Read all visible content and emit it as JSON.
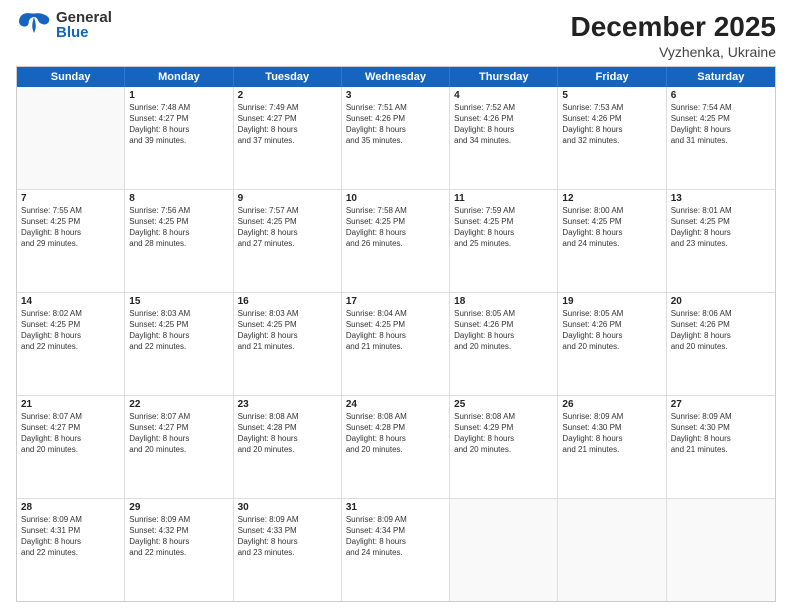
{
  "header": {
    "logo_general": "General",
    "logo_blue": "Blue",
    "title": "December 2025",
    "subtitle": "Vyzhenka, Ukraine"
  },
  "calendar": {
    "days_of_week": [
      "Sunday",
      "Monday",
      "Tuesday",
      "Wednesday",
      "Thursday",
      "Friday",
      "Saturday"
    ],
    "rows": [
      [
        {
          "day": "",
          "lines": []
        },
        {
          "day": "1",
          "lines": [
            "Sunrise: 7:48 AM",
            "Sunset: 4:27 PM",
            "Daylight: 8 hours",
            "and 39 minutes."
          ]
        },
        {
          "day": "2",
          "lines": [
            "Sunrise: 7:49 AM",
            "Sunset: 4:27 PM",
            "Daylight: 8 hours",
            "and 37 minutes."
          ]
        },
        {
          "day": "3",
          "lines": [
            "Sunrise: 7:51 AM",
            "Sunset: 4:26 PM",
            "Daylight: 8 hours",
            "and 35 minutes."
          ]
        },
        {
          "day": "4",
          "lines": [
            "Sunrise: 7:52 AM",
            "Sunset: 4:26 PM",
            "Daylight: 8 hours",
            "and 34 minutes."
          ]
        },
        {
          "day": "5",
          "lines": [
            "Sunrise: 7:53 AM",
            "Sunset: 4:26 PM",
            "Daylight: 8 hours",
            "and 32 minutes."
          ]
        },
        {
          "day": "6",
          "lines": [
            "Sunrise: 7:54 AM",
            "Sunset: 4:25 PM",
            "Daylight: 8 hours",
            "and 31 minutes."
          ]
        }
      ],
      [
        {
          "day": "7",
          "lines": [
            "Sunrise: 7:55 AM",
            "Sunset: 4:25 PM",
            "Daylight: 8 hours",
            "and 29 minutes."
          ]
        },
        {
          "day": "8",
          "lines": [
            "Sunrise: 7:56 AM",
            "Sunset: 4:25 PM",
            "Daylight: 8 hours",
            "and 28 minutes."
          ]
        },
        {
          "day": "9",
          "lines": [
            "Sunrise: 7:57 AM",
            "Sunset: 4:25 PM",
            "Daylight: 8 hours",
            "and 27 minutes."
          ]
        },
        {
          "day": "10",
          "lines": [
            "Sunrise: 7:58 AM",
            "Sunset: 4:25 PM",
            "Daylight: 8 hours",
            "and 26 minutes."
          ]
        },
        {
          "day": "11",
          "lines": [
            "Sunrise: 7:59 AM",
            "Sunset: 4:25 PM",
            "Daylight: 8 hours",
            "and 25 minutes."
          ]
        },
        {
          "day": "12",
          "lines": [
            "Sunrise: 8:00 AM",
            "Sunset: 4:25 PM",
            "Daylight: 8 hours",
            "and 24 minutes."
          ]
        },
        {
          "day": "13",
          "lines": [
            "Sunrise: 8:01 AM",
            "Sunset: 4:25 PM",
            "Daylight: 8 hours",
            "and 23 minutes."
          ]
        }
      ],
      [
        {
          "day": "14",
          "lines": [
            "Sunrise: 8:02 AM",
            "Sunset: 4:25 PM",
            "Daylight: 8 hours",
            "and 22 minutes."
          ]
        },
        {
          "day": "15",
          "lines": [
            "Sunrise: 8:03 AM",
            "Sunset: 4:25 PM",
            "Daylight: 8 hours",
            "and 22 minutes."
          ]
        },
        {
          "day": "16",
          "lines": [
            "Sunrise: 8:03 AM",
            "Sunset: 4:25 PM",
            "Daylight: 8 hours",
            "and 21 minutes."
          ]
        },
        {
          "day": "17",
          "lines": [
            "Sunrise: 8:04 AM",
            "Sunset: 4:25 PM",
            "Daylight: 8 hours",
            "and 21 minutes."
          ]
        },
        {
          "day": "18",
          "lines": [
            "Sunrise: 8:05 AM",
            "Sunset: 4:26 PM",
            "Daylight: 8 hours",
            "and 20 minutes."
          ]
        },
        {
          "day": "19",
          "lines": [
            "Sunrise: 8:05 AM",
            "Sunset: 4:26 PM",
            "Daylight: 8 hours",
            "and 20 minutes."
          ]
        },
        {
          "day": "20",
          "lines": [
            "Sunrise: 8:06 AM",
            "Sunset: 4:26 PM",
            "Daylight: 8 hours",
            "and 20 minutes."
          ]
        }
      ],
      [
        {
          "day": "21",
          "lines": [
            "Sunrise: 8:07 AM",
            "Sunset: 4:27 PM",
            "Daylight: 8 hours",
            "and 20 minutes."
          ]
        },
        {
          "day": "22",
          "lines": [
            "Sunrise: 8:07 AM",
            "Sunset: 4:27 PM",
            "Daylight: 8 hours",
            "and 20 minutes."
          ]
        },
        {
          "day": "23",
          "lines": [
            "Sunrise: 8:08 AM",
            "Sunset: 4:28 PM",
            "Daylight: 8 hours",
            "and 20 minutes."
          ]
        },
        {
          "day": "24",
          "lines": [
            "Sunrise: 8:08 AM",
            "Sunset: 4:28 PM",
            "Daylight: 8 hours",
            "and 20 minutes."
          ]
        },
        {
          "day": "25",
          "lines": [
            "Sunrise: 8:08 AM",
            "Sunset: 4:29 PM",
            "Daylight: 8 hours",
            "and 20 minutes."
          ]
        },
        {
          "day": "26",
          "lines": [
            "Sunrise: 8:09 AM",
            "Sunset: 4:30 PM",
            "Daylight: 8 hours",
            "and 21 minutes."
          ]
        },
        {
          "day": "27",
          "lines": [
            "Sunrise: 8:09 AM",
            "Sunset: 4:30 PM",
            "Daylight: 8 hours",
            "and 21 minutes."
          ]
        }
      ],
      [
        {
          "day": "28",
          "lines": [
            "Sunrise: 8:09 AM",
            "Sunset: 4:31 PM",
            "Daylight: 8 hours",
            "and 22 minutes."
          ]
        },
        {
          "day": "29",
          "lines": [
            "Sunrise: 8:09 AM",
            "Sunset: 4:32 PM",
            "Daylight: 8 hours",
            "and 22 minutes."
          ]
        },
        {
          "day": "30",
          "lines": [
            "Sunrise: 8:09 AM",
            "Sunset: 4:33 PM",
            "Daylight: 8 hours",
            "and 23 minutes."
          ]
        },
        {
          "day": "31",
          "lines": [
            "Sunrise: 8:09 AM",
            "Sunset: 4:34 PM",
            "Daylight: 8 hours",
            "and 24 minutes."
          ]
        },
        {
          "day": "",
          "lines": []
        },
        {
          "day": "",
          "lines": []
        },
        {
          "day": "",
          "lines": []
        }
      ]
    ]
  }
}
